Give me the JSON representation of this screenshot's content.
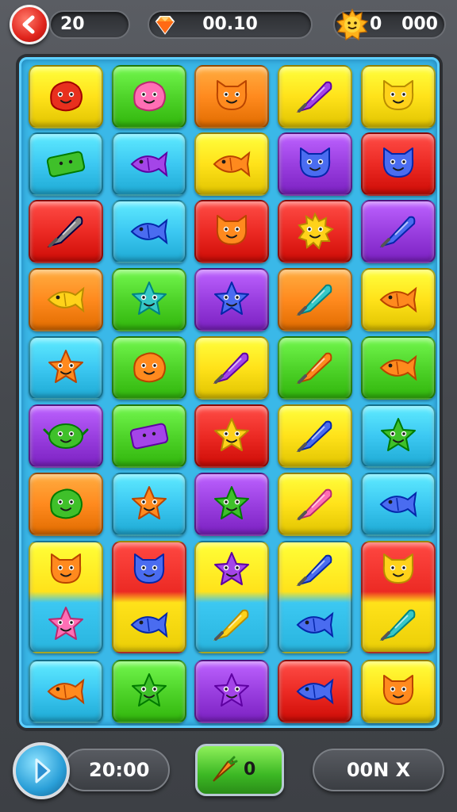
{
  "top_bar": {
    "level_text": "20",
    "gems_text": "00.10",
    "coin_symbol": "0",
    "coins_text": "000"
  },
  "bottom_bar": {
    "score_text": "20:00",
    "boost_text": "0",
    "moves_text": "00N X"
  },
  "colors": {
    "yellow": "#ffe21a",
    "green": "#4fd42a",
    "orange": "#ff8a1e",
    "cyan": "#3cc8f2",
    "red": "#ec2a24",
    "purple": "#9a3fe0",
    "board": "#3ab8e8"
  },
  "board": {
    "rows": [
      [
        {
          "color": "yellow",
          "icon": "red-blob-creature"
        },
        {
          "color": "green",
          "icon": "pink-blob-creature"
        },
        {
          "color": "orange",
          "icon": "orange-cat-creature"
        },
        {
          "color": "yellow",
          "icon": "purple-cone"
        },
        {
          "color": "yellow",
          "icon": "yellow-cat-creature"
        }
      ],
      [
        {
          "color": "cyan",
          "icon": "green-sign-creature"
        },
        {
          "color": "cyan",
          "icon": "purple-fish"
        },
        {
          "color": "yellow",
          "icon": "orange-fish"
        },
        {
          "color": "purple",
          "icon": "blue-cat-creature"
        },
        {
          "color": "red",
          "icon": "blue-cat-creature"
        }
      ],
      [
        {
          "color": "red",
          "icon": "knife-creature"
        },
        {
          "color": "cyan",
          "icon": "blue-fish"
        },
        {
          "color": "red",
          "icon": "orange-cat-creature"
        },
        {
          "color": "red",
          "icon": "yellow-sun-creature"
        },
        {
          "color": "purple",
          "icon": "blue-cone"
        }
      ],
      [
        {
          "color": "orange",
          "icon": "yellow-fish"
        },
        {
          "color": "green",
          "icon": "teal-star-creature"
        },
        {
          "color": "purple",
          "icon": "blue-star-creature"
        },
        {
          "color": "orange",
          "icon": "teal-cone"
        },
        {
          "color": "yellow",
          "icon": "orange-fish"
        }
      ],
      [
        {
          "color": "cyan",
          "icon": "orange-star-creature"
        },
        {
          "color": "green",
          "icon": "orange-blob-creature"
        },
        {
          "color": "yellow",
          "icon": "purple-cone"
        },
        {
          "color": "green",
          "icon": "orange-cone"
        },
        {
          "color": "green",
          "icon": "orange-fish"
        }
      ],
      [
        {
          "color": "purple",
          "icon": "green-alien-creature"
        },
        {
          "color": "green",
          "icon": "purple-sign-creature"
        },
        {
          "color": "red",
          "icon": "yellow-star-creature"
        },
        {
          "color": "yellow",
          "icon": "blue-cone"
        },
        {
          "color": "cyan",
          "icon": "green-star-creature"
        }
      ],
      [
        {
          "color": "orange",
          "icon": "green-blob-creature"
        },
        {
          "color": "cyan",
          "icon": "orange-star-creature"
        },
        {
          "color": "purple",
          "icon": "green-star-creature"
        },
        {
          "color": "yellow",
          "icon": "pink-cone"
        },
        {
          "color": "cyan",
          "icon": "blue-fish"
        }
      ],
      [
        {
          "color": "yellow",
          "tall": true,
          "icon": "orange-cat-creature",
          "icon2": "pink-star-creature"
        },
        {
          "color": "red",
          "tall": true,
          "icon": "blue-cat-creature",
          "icon2": "blue-fish"
        },
        {
          "color": "yellow",
          "tall": true,
          "icon": "purple-star-creature",
          "icon2": "yellow-cone"
        },
        {
          "color": "yellow",
          "tall": true,
          "icon": "blue-cone",
          "icon2": "blue-fish"
        },
        {
          "color": "red",
          "tall": true,
          "icon": "yellow-cat-creature",
          "icon2": "teal-cone"
        }
      ],
      [
        {
          "color": "cyan",
          "icon": "orange-fish"
        },
        {
          "color": "green",
          "icon": "green-star-creature"
        },
        {
          "color": "purple",
          "icon": "purple-star-creature"
        },
        {
          "color": "red",
          "icon": "blue-fish"
        },
        {
          "color": "yellow",
          "icon": "orange-cat-creature"
        }
      ]
    ]
  }
}
